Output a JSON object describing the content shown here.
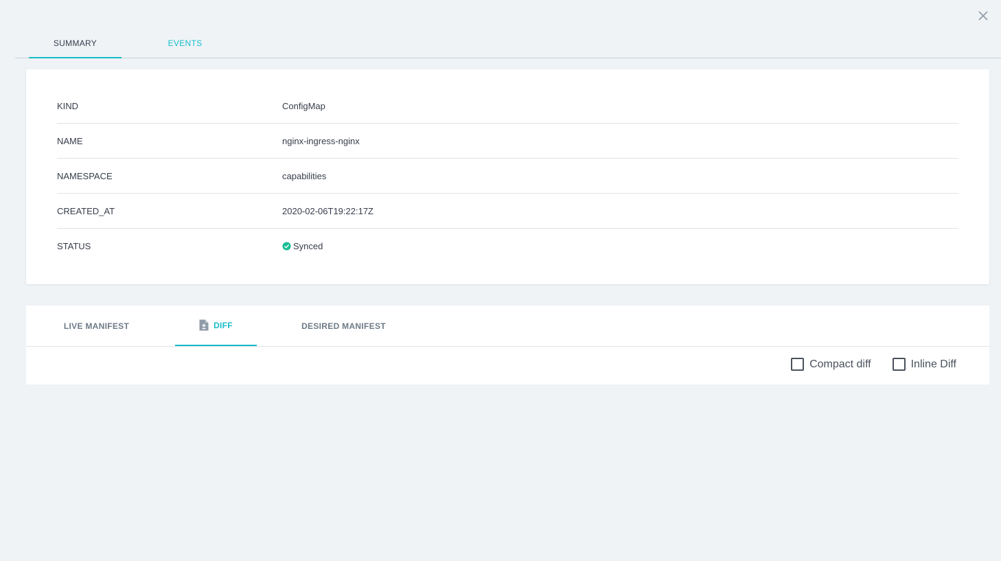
{
  "top_tabs": {
    "summary": "SUMMARY",
    "events": "EVENTS"
  },
  "summary": {
    "rows": [
      {
        "key": "KIND",
        "value": "ConfigMap"
      },
      {
        "key": "NAME",
        "value": "nginx-ingress-nginx"
      },
      {
        "key": "NAMESPACE",
        "value": "capabilities"
      },
      {
        "key": "CREATED_AT",
        "value": "2020-02-06T19:22:17Z"
      },
      {
        "key": "STATUS",
        "value": "Synced"
      }
    ],
    "status_color": "#18be94"
  },
  "manifest_tabs": {
    "live": "LIVE MANIFEST",
    "diff": "DIFF",
    "desired": "DESIRED MANIFEST"
  },
  "diff_options": {
    "compact": "Compact diff",
    "inline": "Inline Diff"
  },
  "icons": {
    "close": "close-icon",
    "status": "check-circle-icon",
    "diff": "file-diff-icon"
  },
  "colors": {
    "accent": "#18bcca",
    "background": "#eff3f6"
  }
}
